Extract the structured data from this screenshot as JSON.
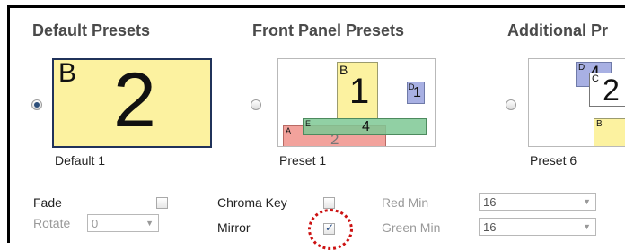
{
  "headings": {
    "default": "Default Presets",
    "front": "Front Panel Presets",
    "additional": "Additional Pr"
  },
  "presets": [
    {
      "caption": "Default 1",
      "selected": true,
      "boxes": [
        {
          "label": "B",
          "number": "2"
        }
      ]
    },
    {
      "caption": "Preset 1",
      "selected": false,
      "boxes": [
        {
          "label": "B",
          "number": "1"
        },
        {
          "label": "D",
          "number": "1"
        },
        {
          "label": "A",
          "number": "2"
        },
        {
          "label": "E",
          "number": "4"
        }
      ]
    },
    {
      "caption": "Preset 6",
      "selected": false,
      "boxes": [
        {
          "label": "D",
          "number": "4"
        },
        {
          "label": "C",
          "number": "2"
        },
        {
          "label": "B",
          "number": ""
        }
      ]
    }
  ],
  "controls": {
    "fade": {
      "label": "Fade",
      "checked": false
    },
    "rotate": {
      "label": "Rotate",
      "value": "0"
    },
    "chroma_key": {
      "label": "Chroma Key",
      "checked": false
    },
    "mirror": {
      "label": "Mirror",
      "checked": true
    },
    "red_min": {
      "label": "Red Min",
      "value": "16"
    },
    "green_min": {
      "label": "Green Min",
      "value": "16"
    }
  },
  "colors": {
    "yellow": "#fcf2a0",
    "green": "#8fd0a6",
    "red": "#f2a29c",
    "blue": "#a8b0e3",
    "selected_border": "#20325a",
    "highlight": "#cc1111"
  }
}
